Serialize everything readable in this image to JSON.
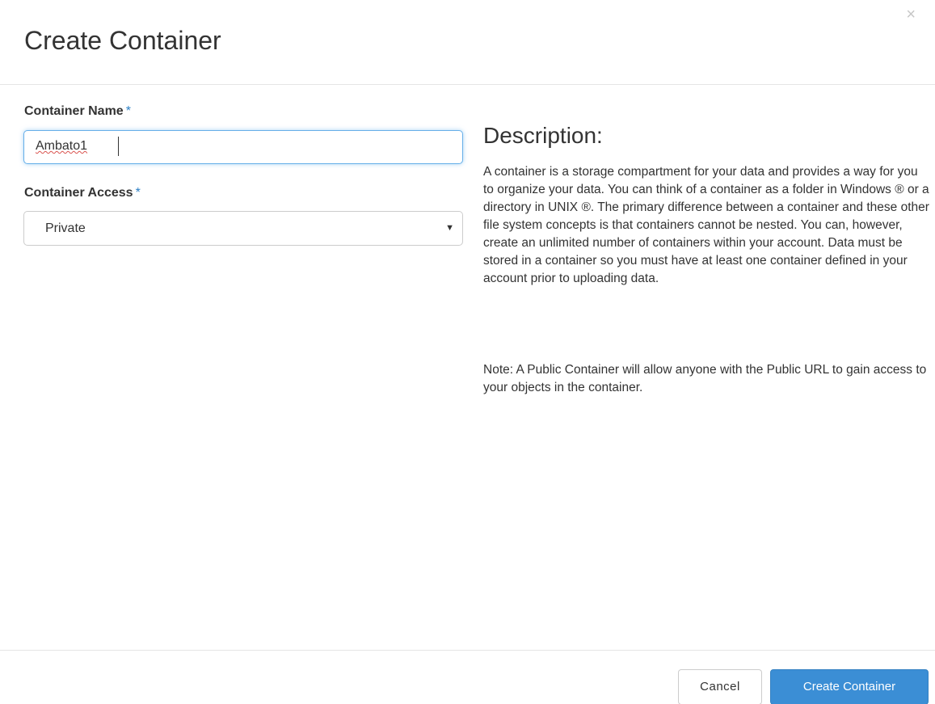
{
  "dialog": {
    "title": "Create Container",
    "close_glyph": "×"
  },
  "form": {
    "name_label": "Container Name",
    "name_required": "*",
    "name_value": "Ambato1",
    "access_label": "Container Access",
    "access_required": "*",
    "access_selected": "Private",
    "access_arrow": "▼"
  },
  "description": {
    "heading": "Description:",
    "body": "A container is a storage compartment for your data and provides a way for you to organize your data. You can think of a container as a folder in Windows ® or a directory in UNIX ®. The primary difference between a container and these other file system concepts is that containers cannot be nested. You can, however, create an unlimited number of containers within your account. Data must be stored in a container so you must have at least one container defined in your account prior to uploading data.",
    "note": "Note: A Public Container will allow anyone with the Public URL to gain access to your objects in the container."
  },
  "footer": {
    "cancel_label": "Cancel",
    "create_label": "Create Container"
  },
  "colors": {
    "primary_button": "#3b8ed5",
    "focus_border": "#66afe9",
    "required_marker": "#2c7fc5"
  },
  "icons": {
    "close": "close-icon",
    "select_arrow": "caret-down-icon"
  }
}
